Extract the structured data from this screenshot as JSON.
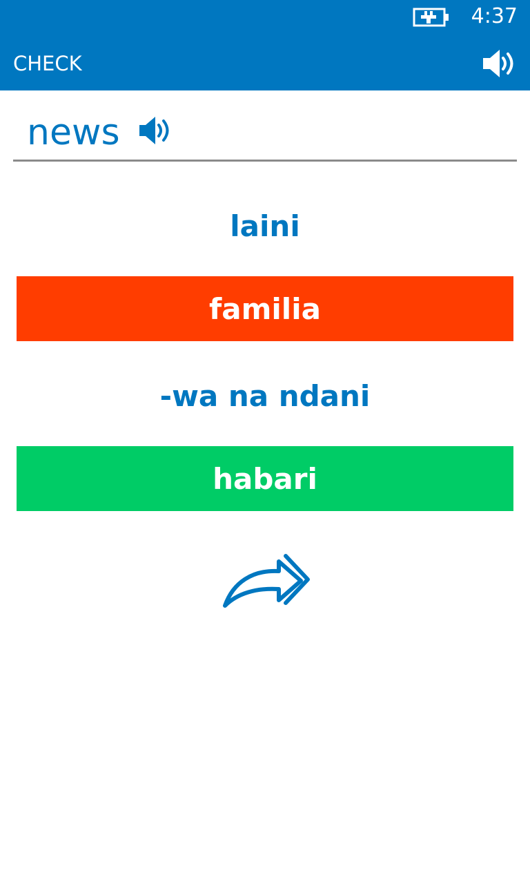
{
  "status_bar": {
    "time": "4:37",
    "battery_icon": "battery-charging-icon"
  },
  "header": {
    "title": "CHECK",
    "speaker_icon": "speaker-icon"
  },
  "question": {
    "word": "news",
    "speaker_icon": "speaker-icon"
  },
  "options": [
    {
      "label": "laini",
      "state": "neutral"
    },
    {
      "label": "familia",
      "state": "wrong"
    },
    {
      "label": "-wa na ndani",
      "state": "neutral"
    },
    {
      "label": "habari",
      "state": "correct"
    }
  ],
  "next_button": {
    "icon": "forward-arrow-icon"
  },
  "colors": {
    "accent": "#0077c0",
    "wrong": "#ff3d00",
    "correct": "#00cc66",
    "divider": "#8a8a8a"
  }
}
